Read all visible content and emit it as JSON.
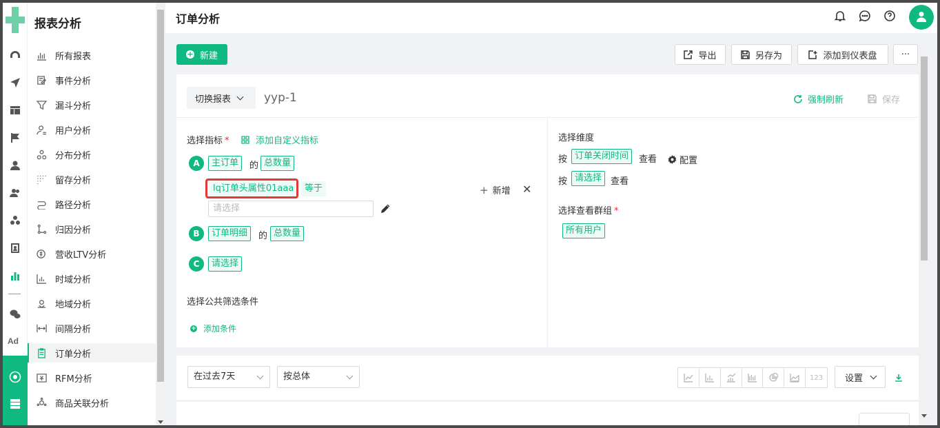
{
  "sidebar": {
    "title": "报表分析",
    "items": [
      {
        "label": "所有报表",
        "icon": "bar-chart-icon"
      },
      {
        "label": "事件分析",
        "icon": "edit-list-icon"
      },
      {
        "label": "漏斗分析",
        "icon": "funnel-icon"
      },
      {
        "label": "用户分析",
        "icon": "user-icon"
      },
      {
        "label": "分布分析",
        "icon": "distribution-icon"
      },
      {
        "label": "留存分析",
        "icon": "retention-icon"
      },
      {
        "label": "路径分析",
        "icon": "path-icon"
      },
      {
        "label": "归因分析",
        "icon": "attribution-icon"
      },
      {
        "label": "营收LTV分析",
        "icon": "revenue-icon"
      },
      {
        "label": "时域分析",
        "icon": "time-chart-icon"
      },
      {
        "label": "地域分析",
        "icon": "location-icon"
      },
      {
        "label": "间隔分析",
        "icon": "interval-icon"
      },
      {
        "label": "订单分析",
        "icon": "order-icon"
      },
      {
        "label": "RFM分析",
        "icon": "rfm-icon"
      },
      {
        "label": "商品关联分析",
        "icon": "product-link-icon"
      }
    ],
    "active": "订单分析"
  },
  "rail": {
    "ad_label": "Ad"
  },
  "header": {
    "title": "订单分析"
  },
  "toolbar": {
    "new_label": "新建",
    "export_label": "导出",
    "saveas_label": "另存为",
    "add_dashboard_label": "添加到仪表盘",
    "more_label": "···"
  },
  "report": {
    "switch_label": "切换报表",
    "name": "yyp-1",
    "refresh_label": "强制刷新",
    "save_label": "保存"
  },
  "metrics": {
    "label": "选择指标",
    "required_mark": "*",
    "add_custom": "添加自定义指标",
    "of_word": "的",
    "items": [
      {
        "letter": "A",
        "source": "主订单",
        "measure": "总数量"
      },
      {
        "letter": "B",
        "source": "订单明细",
        "measure": "总数量"
      },
      {
        "letter": "C",
        "source": "请选择"
      }
    ],
    "filter": {
      "property": "lq订单头属性01aaa",
      "operator": "等于",
      "value_placeholder": "请选择",
      "add_label": "新增",
      "close_label": "✕"
    }
  },
  "common_filter": {
    "label": "选择公共筛选条件",
    "add_label": "添加条件"
  },
  "dimensions": {
    "label": "选择维度",
    "by_word": "按",
    "view_word": "查看",
    "first": "订单关闭时间",
    "config_label": "配置",
    "second": "请选择"
  },
  "groups": {
    "label": "选择查看群组",
    "required_mark": "*",
    "value": "所有用户"
  },
  "query": {
    "time_range": "在过去7天",
    "group_by": "按总体",
    "settings_label": "设置",
    "number_label": "123"
  }
}
